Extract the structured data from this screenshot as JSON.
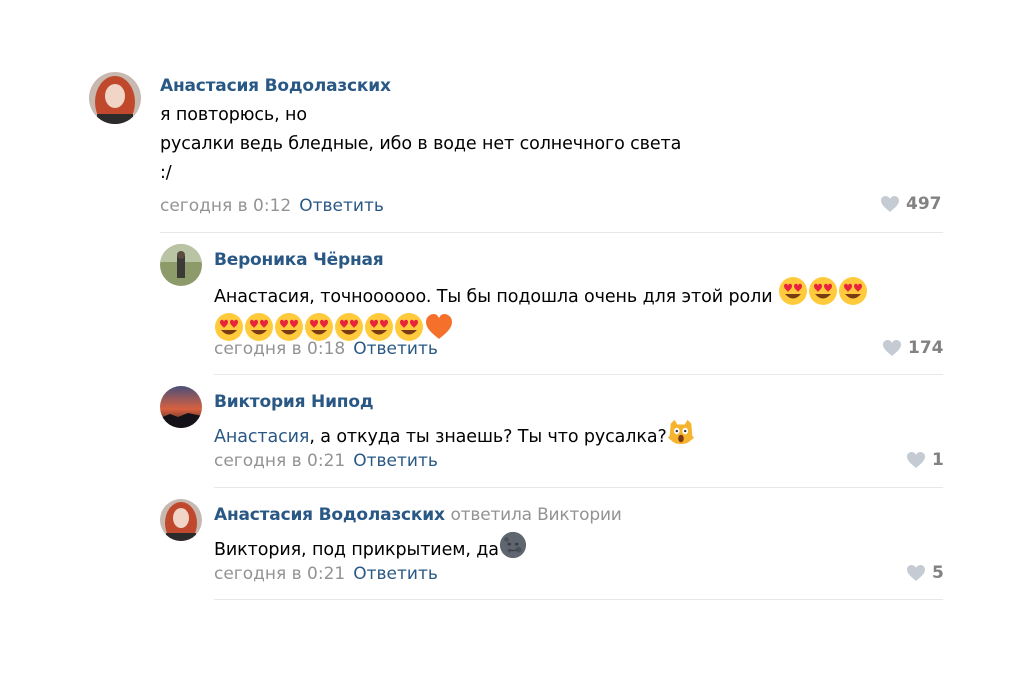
{
  "comments": [
    {
      "author": "Анастасия Водолазских",
      "lines": [
        "я повторюсь, но",
        "русалки ведь бледные, ибо в воде нет солнечного света",
        ":/"
      ],
      "time": "сегодня в 0:12",
      "reply_label": "Ответить",
      "likes": "497"
    },
    {
      "author": "Вероника Чёрная",
      "text": "Анастасия, точнoooooo. Ты бы подошла очень для этой роли",
      "time": "сегодня в 0:18",
      "reply_label": "Ответить",
      "likes": "174",
      "emojis": [
        "heart-eyes-emoji",
        "orange-heart-emoji"
      ]
    },
    {
      "author": "Виктория Нипод",
      "mention": "Анастасия",
      "text": ", а откуда ты знаешь? Ты что русалка?",
      "time": "сегодня в 0:21",
      "reply_label": "Ответить",
      "likes": "1",
      "emojis": [
        "scream-cat-emoji"
      ]
    },
    {
      "author": "Анастасия Водолазских",
      "replied_to": "ответила Виктории",
      "text": "Виктория, под прикрытием, да",
      "time": "сегодня в 0:21",
      "reply_label": "Ответить",
      "likes": "5",
      "emojis": [
        "new-moon-face-emoji"
      ]
    }
  ],
  "colors": {
    "author": "#2a5885",
    "meta": "#939393",
    "likes": "#828282",
    "divider": "#e7e8ec"
  },
  "icons": [
    "heart-icon"
  ]
}
